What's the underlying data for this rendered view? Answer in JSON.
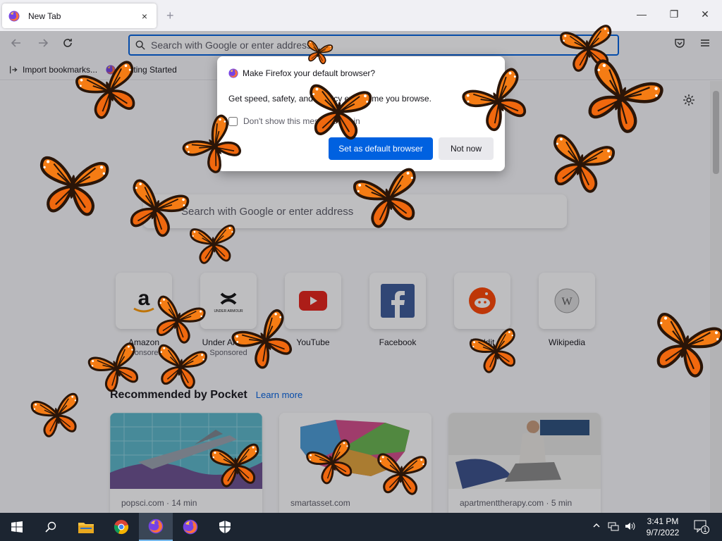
{
  "tab": {
    "title": "New Tab",
    "close": "×",
    "new_tab": "+"
  },
  "window": {
    "minimize": "—",
    "maximize": "❐",
    "close": "✕"
  },
  "urlbar": {
    "placeholder": "Search with Google or enter address"
  },
  "bookmarks": [
    {
      "label": "Import bookmarks..."
    },
    {
      "label": "Getting Started"
    }
  ],
  "newtab": {
    "search_placeholder": "Search with Google or enter address",
    "shortcuts": [
      {
        "label": "Amazon",
        "sub": "Sponsored",
        "icon": "amazon-icon"
      },
      {
        "label": "Under Armour",
        "sub": "Sponsored",
        "icon": "under-armour-icon"
      },
      {
        "label": "YouTube",
        "sub": "",
        "icon": "youtube-icon"
      },
      {
        "label": "Facebook",
        "sub": "",
        "icon": "facebook-icon"
      },
      {
        "label": "Reddit",
        "sub": "",
        "icon": "reddit-icon"
      },
      {
        "label": "Wikipedia",
        "sub": "",
        "icon": "wikipedia-icon"
      }
    ],
    "pocket": {
      "title": "Recommended by Pocket",
      "learn_more": "Learn more",
      "cards": [
        {
          "source": "popsci.com · 14 min"
        },
        {
          "source": "smartasset.com"
        },
        {
          "source": "apartmenttherapy.com · 5 min"
        }
      ]
    }
  },
  "modal": {
    "title": "Make Firefox your default browser?",
    "body": "Get speed, safety, and privacy every time you browse.",
    "checkbox_label": "Don't show this message again",
    "primary_button": "Set as default browser",
    "secondary_button": "Not now"
  },
  "taskbar": {
    "time": "3:41 PM",
    "date": "9/7/2022",
    "notification_count": "1"
  },
  "colors": {
    "accent": "#0061e0",
    "taskbar": "#1c2531",
    "butterfly": "#f07a12"
  }
}
